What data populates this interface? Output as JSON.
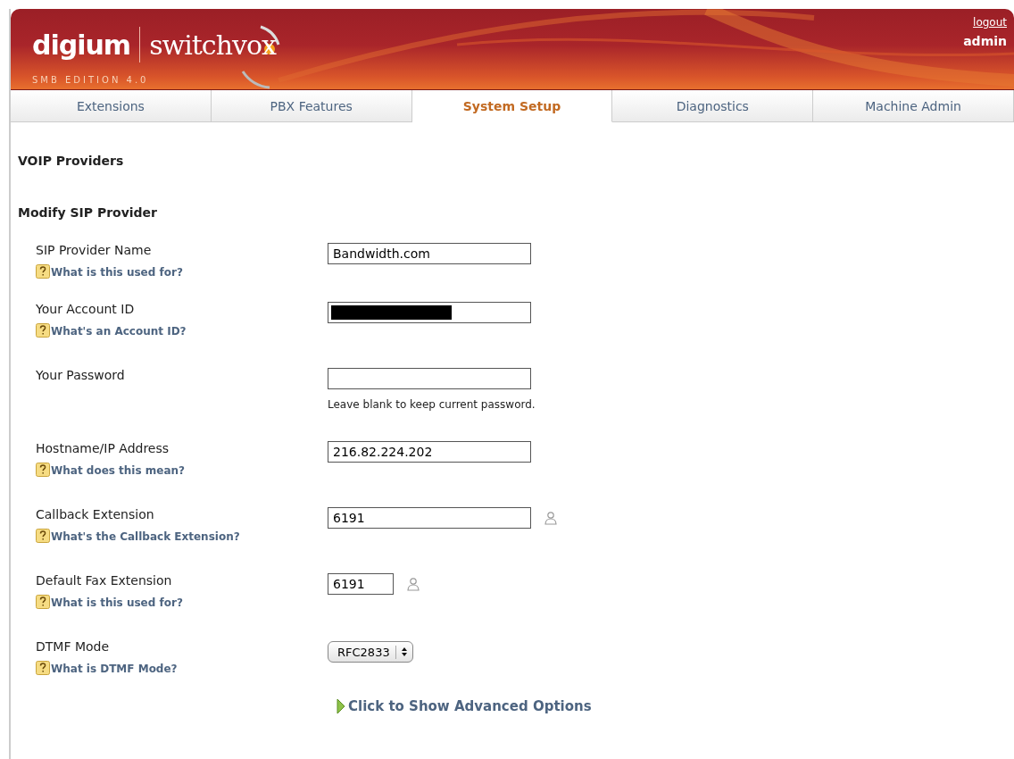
{
  "header": {
    "brand": "digium",
    "product": "switchvox",
    "edition": "SMB EDITION 4.0",
    "logout": "logout",
    "user": "admin"
  },
  "tabs": [
    {
      "label": "Extensions",
      "selected": false
    },
    {
      "label": "PBX Features",
      "selected": false
    },
    {
      "label": "System Setup",
      "selected": true
    },
    {
      "label": "Diagnostics",
      "selected": false
    },
    {
      "label": "Machine Admin",
      "selected": false
    }
  ],
  "page_title": "VOIP Providers",
  "section_title": "Modify SIP Provider",
  "fields": [
    {
      "kind": "text",
      "label": "SIP Provider Name",
      "value": "Bandwidth.com",
      "help": "What is this used for?"
    },
    {
      "kind": "redacted",
      "label": "Your Account ID",
      "help": "What's an Account ID?"
    },
    {
      "kind": "text",
      "label": "Your Password",
      "note": "Leave blank to keep current password."
    },
    {
      "kind": "text",
      "label": "Hostname/IP Address",
      "value": "216.82.224.202",
      "help": "What does this mean?"
    },
    {
      "kind": "lookup",
      "label": "Callback Extension",
      "value": "6191",
      "help": "What's the Callback Extension?"
    },
    {
      "kind": "short-lookup",
      "label": "Default Fax Extension",
      "value": "6191",
      "help": "What is this used for?"
    },
    {
      "kind": "select",
      "label": "DTMF Mode",
      "value": "RFC2833",
      "help": "What is DTMF Mode?"
    }
  ],
  "advanced_link": "Click to Show Advanced Options"
}
